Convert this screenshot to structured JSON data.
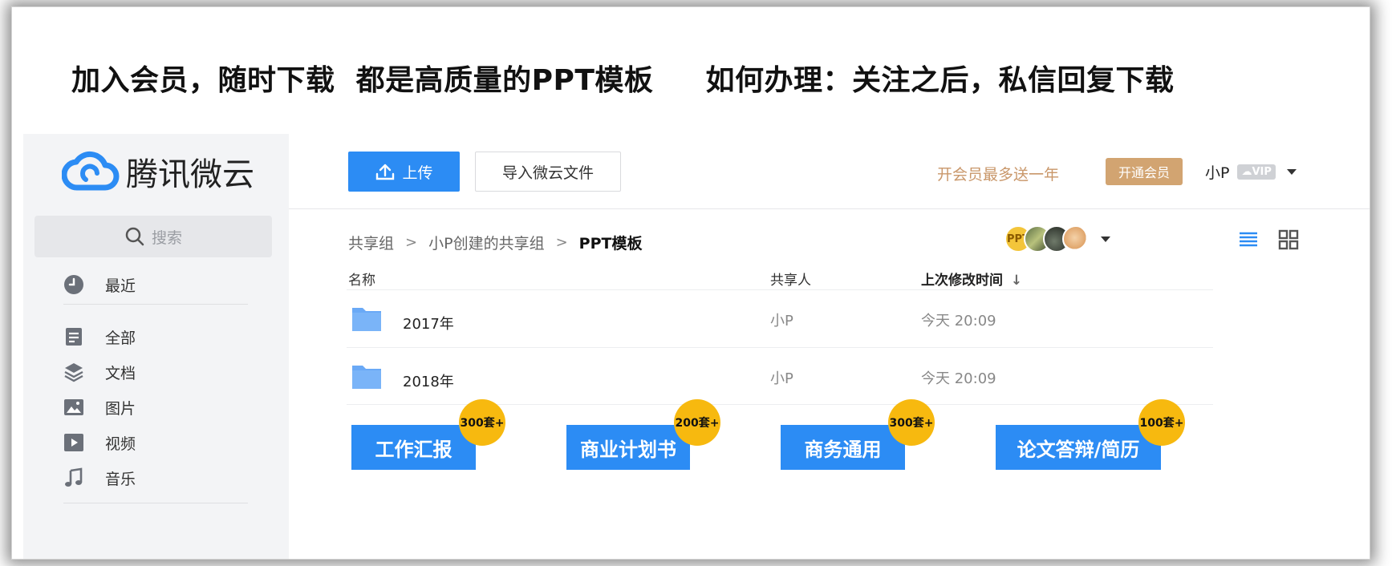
{
  "banner": {
    "text": "加入会员，随时下载  都是高质量的PPT模板     如何办理：关注之后，私信回复下载"
  },
  "brand": {
    "name": "腾讯微云",
    "icon": "cloud-logo-icon",
    "color": "#2c8cf4"
  },
  "search": {
    "placeholder": "搜索"
  },
  "sidebar": {
    "items": [
      {
        "label": "最近",
        "icon": "clock-icon"
      },
      {
        "label": "全部",
        "icon": "file-icon"
      },
      {
        "label": "文档",
        "icon": "layers-icon"
      },
      {
        "label": "图片",
        "icon": "image-icon"
      },
      {
        "label": "视频",
        "icon": "play-icon"
      },
      {
        "label": "音乐",
        "icon": "music-note-icon"
      }
    ]
  },
  "toolbar": {
    "upload_label": "上传",
    "import_label": "导入微云文件",
    "promo_text": "开会员最多送一年",
    "vip_button_label": "开通会员",
    "user_name": "小P",
    "vip_badge": "VIP"
  },
  "breadcrumb": {
    "items": [
      "共享组",
      "小P创建的共享组",
      "PPT模板"
    ]
  },
  "members": {
    "first_avatar_text": "PPT"
  },
  "table": {
    "headers": {
      "name": "名称",
      "owner": "共享人",
      "modified": "上次修改时间"
    },
    "rows": [
      {
        "name": "2017年",
        "owner": "小P",
        "modified": "今天 20:09"
      },
      {
        "name": "2018年",
        "owner": "小P",
        "modified": "今天 20:09"
      }
    ]
  },
  "tiles": [
    {
      "label": "工作汇报",
      "badge": "300套+"
    },
    {
      "label": "商业计划书",
      "badge": "200套+"
    },
    {
      "label": "商务通用",
      "badge": "300套+"
    },
    {
      "label": "论文答辩/简历",
      "badge": "100套+"
    }
  ],
  "colors": {
    "accent": "#2c8cf4",
    "vip": "#d2a471",
    "badge": "#f7b90f",
    "promo": "#c9976a"
  }
}
